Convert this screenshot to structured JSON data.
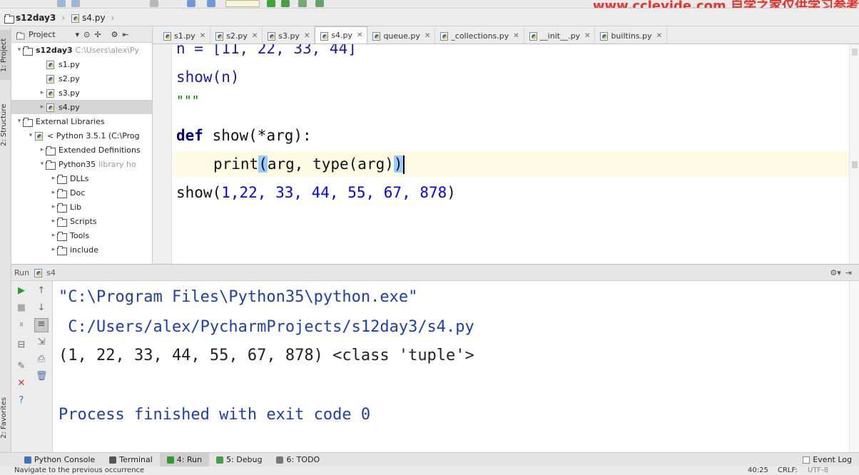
{
  "watermark": "www.cclevide.com 自学之家仅供学习参考",
  "navbar": {
    "project": "s12day3",
    "file": "s4.py"
  },
  "leftstrip": {
    "project_tab": "1: Project",
    "structure_tab": "2: Structure",
    "favorites_tab": "2: Favorites"
  },
  "project": {
    "header": "Project",
    "tree": [
      {
        "label": "s12day3",
        "dim": "C:\\Users\\alex\\Py",
        "icon": "folder",
        "indent": 0,
        "arrow": "▾"
      },
      {
        "label": "s1.py",
        "icon": "py",
        "indent": 2,
        "arrow": ""
      },
      {
        "label": "s2.py",
        "icon": "py",
        "indent": 2,
        "arrow": ""
      },
      {
        "label": "s3.py",
        "icon": "py",
        "indent": 2,
        "arrow": "▸"
      },
      {
        "label": "s4.py",
        "icon": "py",
        "indent": 2,
        "arrow": "▸",
        "selected": true
      },
      {
        "label": "External Libraries",
        "icon": "lib",
        "indent": 0,
        "arrow": "▾"
      },
      {
        "label": "< Python 3.5.1 (C:\\Prog",
        "icon": "py",
        "indent": 1,
        "arrow": "▾"
      },
      {
        "label": "Extended Definitions",
        "icon": "lib",
        "indent": 2,
        "arrow": "▸"
      },
      {
        "label": "Python35",
        "dim": "library ho",
        "icon": "folder",
        "indent": 2,
        "arrow": "▾"
      },
      {
        "label": "DLLs",
        "icon": "folder",
        "indent": 3,
        "arrow": "▸"
      },
      {
        "label": "Doc",
        "icon": "folder",
        "indent": 3,
        "arrow": "▸"
      },
      {
        "label": "Lib",
        "icon": "folder",
        "indent": 3,
        "arrow": "▸"
      },
      {
        "label": "Scripts",
        "icon": "folder",
        "indent": 3,
        "arrow": "▸"
      },
      {
        "label": "Tools",
        "icon": "folder",
        "indent": 3,
        "arrow": "▸"
      },
      {
        "label": "include",
        "icon": "folder",
        "indent": 3,
        "arrow": "▸"
      }
    ]
  },
  "tabs": [
    {
      "label": "s1.py"
    },
    {
      "label": "s2.py"
    },
    {
      "label": "s3.py"
    },
    {
      "label": "s4.py",
      "active": true
    },
    {
      "label": "queue.py"
    },
    {
      "label": "_collections.py"
    },
    {
      "label": "__init__.py"
    },
    {
      "label": "builtins.py"
    }
  ],
  "editor": {
    "line1": "n = [11, 22, 33, 44]",
    "line2": "show(n)",
    "line3": "\"\"\"",
    "line4_kw": "def",
    "line4_rest": " show(*arg):",
    "line5_fn": "print",
    "line5_open": "(",
    "line5_mid": "arg, type(arg)",
    "line5_close": ")",
    "line6_fn": "show(",
    "line6_args": "1,22, 33, 44, 55, 67, 878",
    "line6_close": ")"
  },
  "run": {
    "label": "Run",
    "config": "s4"
  },
  "console": {
    "line1": "\"C:\\Program Files\\Python35\\python.exe\"",
    "line2": " C:/Users/alex/PycharmProjects/s12day3/s4.py",
    "line3": "(1, 22, 33, 44, 55, 67, 878) <class 'tuple'>",
    "line4": "Process finished with exit code 0"
  },
  "bottom_tools": [
    {
      "label": "Python Console"
    },
    {
      "label": "Terminal"
    },
    {
      "label": "4: Run",
      "active": true
    },
    {
      "label": "5: Debug"
    },
    {
      "label": "6: TODO"
    }
  ],
  "event_log": "Event Log",
  "status": {
    "message": "Navigate to the previous occurrence",
    "position": "40:25",
    "line_sep": "CRLF:",
    "encoding": "UTF-8"
  }
}
